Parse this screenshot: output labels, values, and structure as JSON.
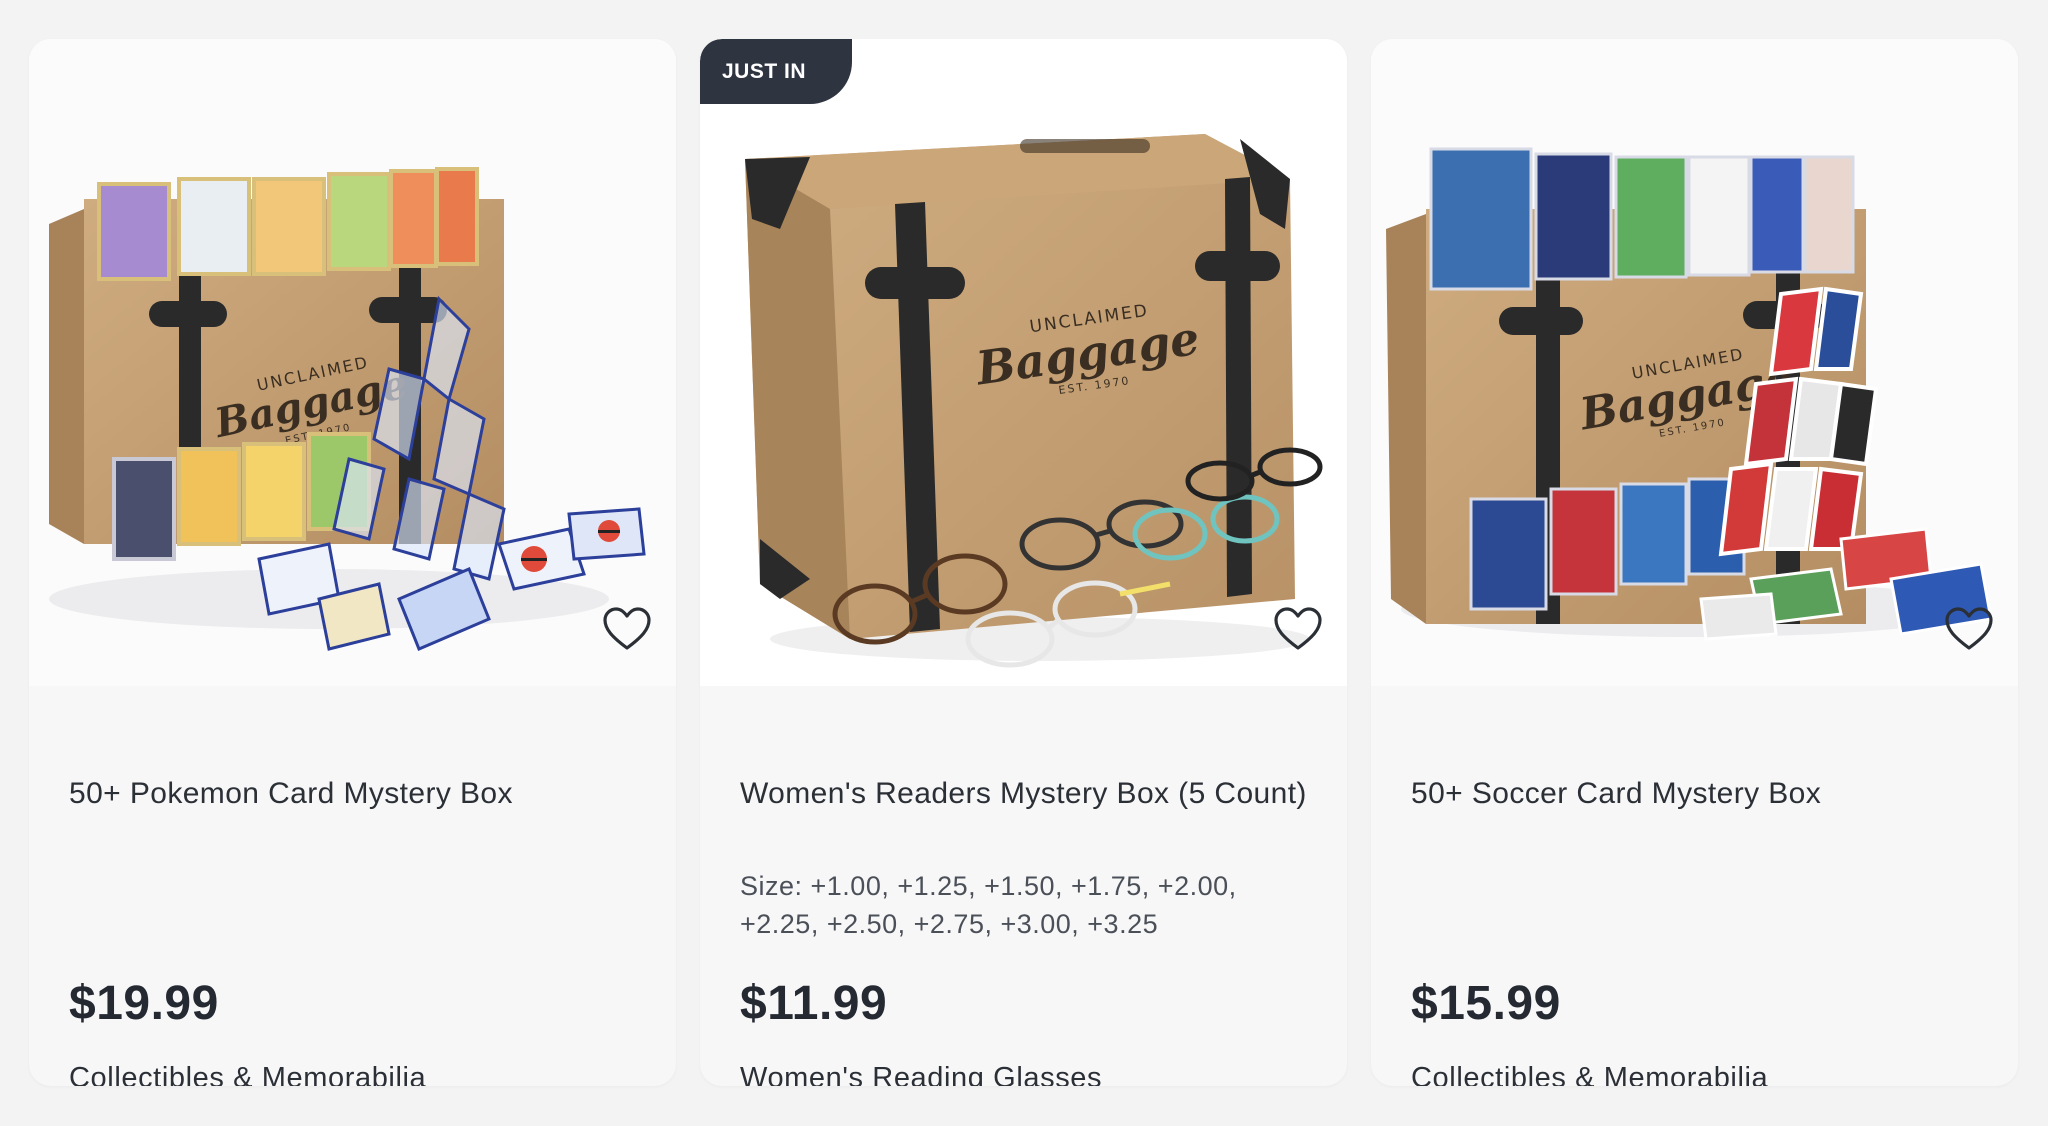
{
  "products": [
    {
      "title": "50+ Pokemon Card Mystery Box",
      "meta": "",
      "price": "$19.99",
      "category": "Collectibles & Memorabilia",
      "badge": "",
      "image_icon": "pokemon-mystery-box-photo",
      "favorite_icon": "heart-outline-icon"
    },
    {
      "title": "Women's Readers Mystery Box (5 Count)",
      "meta": "Size: +1.00, +1.25, +1.50, +1.75, +2.00, +2.25, +2.50, +2.75, +3.00, +3.25",
      "price": "$11.99",
      "category": "Women's Reading Glasses",
      "badge": "JUST IN",
      "image_icon": "readers-mystery-box-photo",
      "favorite_icon": "heart-outline-icon"
    },
    {
      "title": "50+ Soccer Card Mystery Box",
      "meta": "",
      "price": "$15.99",
      "category": "Collectibles & Memorabilia",
      "badge": "",
      "image_icon": "soccer-mystery-box-photo",
      "favorite_icon": "heart-outline-icon"
    }
  ],
  "box_print": {
    "line1": "UNCLAIMED",
    "line2": "Baggage",
    "line3": "EST. 1970"
  },
  "colors": {
    "page_bg": "#f3f3f4",
    "card_bg": "#f7f7f8",
    "badge_bg": "#2e3440",
    "text": "#2b2f36",
    "cardboard": "#c9a57a",
    "strap": "#2a2a2a"
  }
}
